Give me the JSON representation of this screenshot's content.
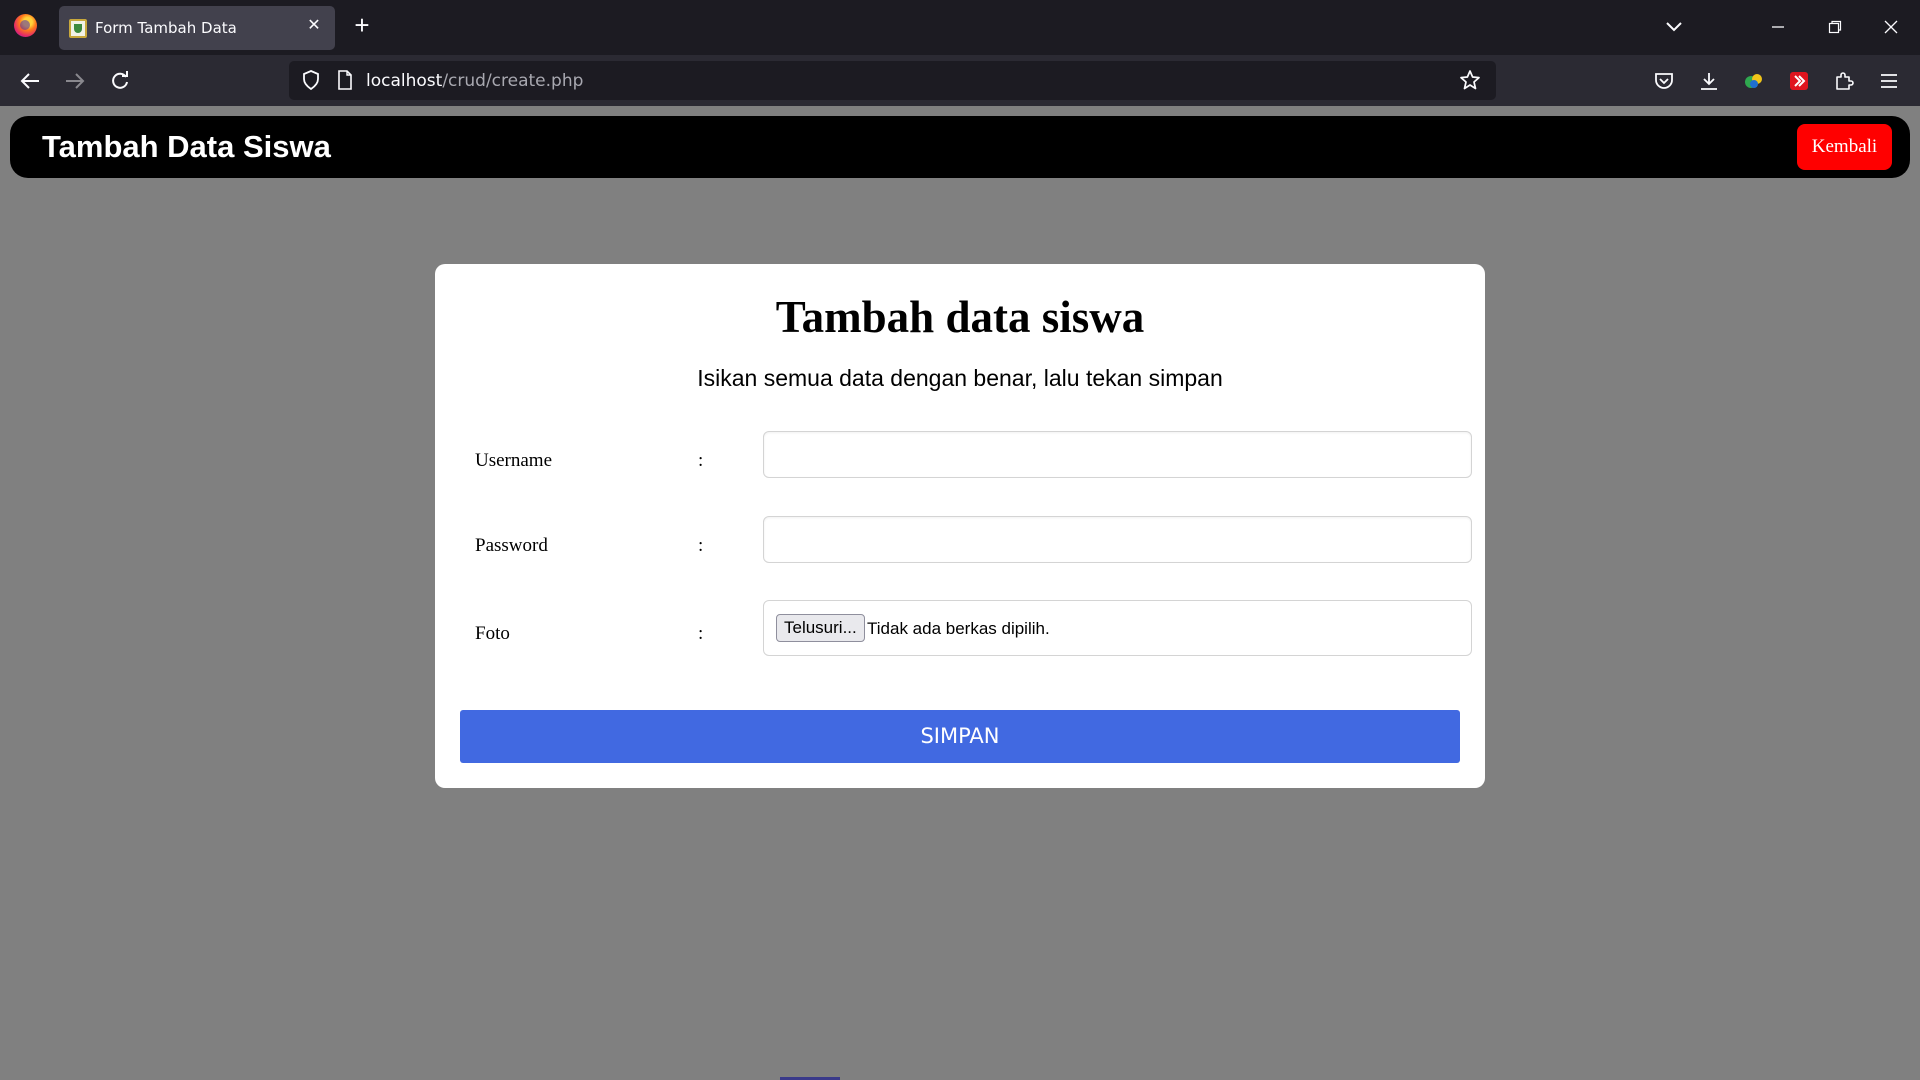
{
  "browser": {
    "tab_title": "Form Tambah Data",
    "url_host": "localhost",
    "url_path": "/crud/create.php"
  },
  "header": {
    "title": "Tambah Data Siswa",
    "back_label": "Kembali"
  },
  "card": {
    "title": "Tambah data siswa",
    "subtitle": "Isikan semua data dengan benar, lalu tekan simpan"
  },
  "form": {
    "fields": [
      {
        "label": "Username",
        "separator": ":",
        "value": ""
      },
      {
        "label": "Password",
        "separator": ":",
        "value": ""
      },
      {
        "label": "Foto",
        "separator": ":"
      }
    ],
    "file_button_label": "Telusuri...",
    "file_status": "Tidak ada berkas dipilih.",
    "submit_label": "SIMPAN"
  },
  "colors": {
    "header_bg": "#000000",
    "back_button": "#ff0000",
    "submit_button": "#4169e1",
    "page_bg": "#808080"
  }
}
